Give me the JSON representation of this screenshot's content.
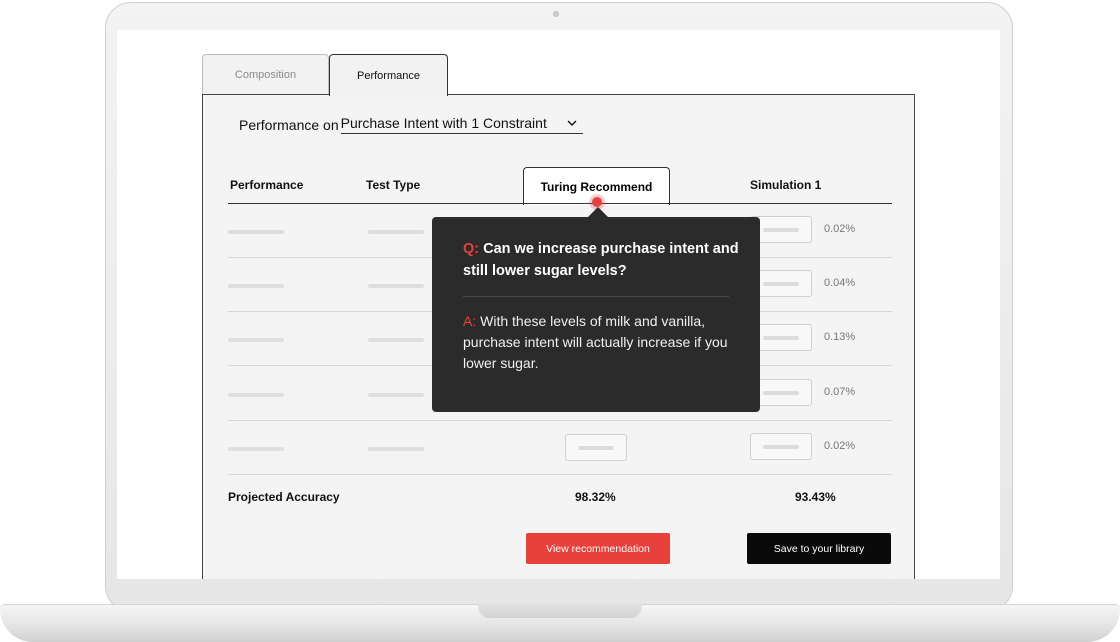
{
  "tabs": [
    {
      "label": "Composition",
      "active": false
    },
    {
      "label": "Performance",
      "active": true
    }
  ],
  "selector": {
    "prefix": "Performance on",
    "value": "Purchase Intent with 1 Constraint"
  },
  "table": {
    "headers": {
      "performance": "Performance",
      "test_type": "Test Type",
      "turing": "Turing Recommend",
      "simulation": "Simulation 1"
    },
    "simulation_values": [
      "0.02%",
      "0.04%",
      "0.13%",
      "0.07%",
      "0.02%"
    ]
  },
  "accuracy": {
    "label": "Projected Accuracy",
    "turing": "98.32%",
    "simulation": "93.43%"
  },
  "buttons": {
    "view": "View recommendation",
    "save": "Save to your library"
  },
  "tooltip": {
    "q_tag": "Q:",
    "question": "Can we increase purchase intent and still lower sugar levels?",
    "a_tag": "A:",
    "answer": "With these levels of milk and vanilla, purchase intent will actually increase if you lower sugar."
  },
  "colors": {
    "accent": "#e8403a",
    "tooltip_bg": "#2b2b2b",
    "save_button": "#0a0a0a"
  },
  "icons": {
    "selector": "chevron-down-icon"
  }
}
